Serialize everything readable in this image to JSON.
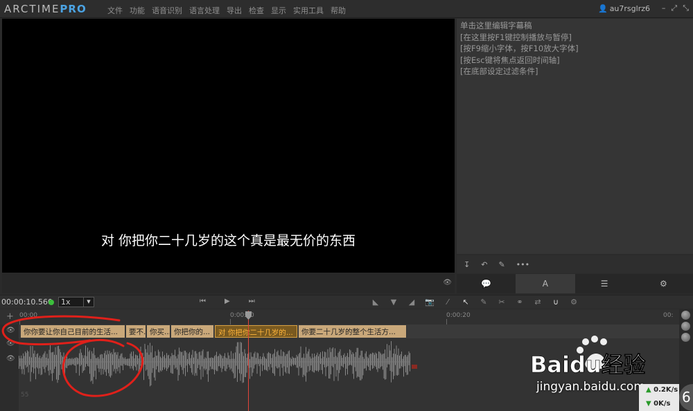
{
  "app": {
    "logo_main": "ARCTIME",
    "logo_pro": "PRO",
    "menu": [
      "文件",
      "功能",
      "语音识别",
      "语言处理",
      "导出",
      "检查",
      "显示",
      "实用工具",
      "帮助"
    ],
    "user": "au7rsglrz6",
    "window_buttons": [
      "–",
      "⤢",
      "⤡"
    ]
  },
  "video": {
    "subtitle": "对 你把你二十几岁的这个真是最无价的东西"
  },
  "text_panel": {
    "lines": [
      "单击这里编辑字幕稿",
      "[在这里按F1键控制播放与暂停]",
      "[按F9缩小字体，按F10放大字体]",
      "[按Esc键将焦点返回时间轴]",
      "[在底部设定过滤条件]"
    ],
    "tabs": [
      {
        "icon": "speech-bubble-icon",
        "glyph": "💬"
      },
      {
        "icon": "font-icon",
        "glyph": "A"
      },
      {
        "icon": "list-icon",
        "glyph": "☰"
      },
      {
        "icon": "sliders-icon",
        "glyph": "⚙"
      }
    ]
  },
  "toolbar": {
    "time": "00:00:10.560",
    "speed": "1x",
    "speed_arrow": "▼"
  },
  "timeline": {
    "ticks": [
      "00:00",
      "0:00:10",
      "0:00:20",
      "00:"
    ],
    "subtitles": [
      "你你要让你自己目前的生活...",
      "要不...",
      "你买...",
      "你把你的...",
      "对 你把你二十几岁的...",
      "你要二十几岁的整个生活方..."
    ],
    "bottom_label": "55"
  },
  "watermark": {
    "text": "Baidu经验",
    "url": "jingyan.baidu.com"
  },
  "network": {
    "up": "0.2",
    "down": "0",
    "unit": "K/s",
    "bubble": "6"
  },
  "colors": {
    "accent": "#4ba3e3",
    "subtitle_block": "#c9a87a",
    "active_block_text": "#ffb43a",
    "playhead": "#e2443a",
    "annotation": "#e0201a"
  }
}
